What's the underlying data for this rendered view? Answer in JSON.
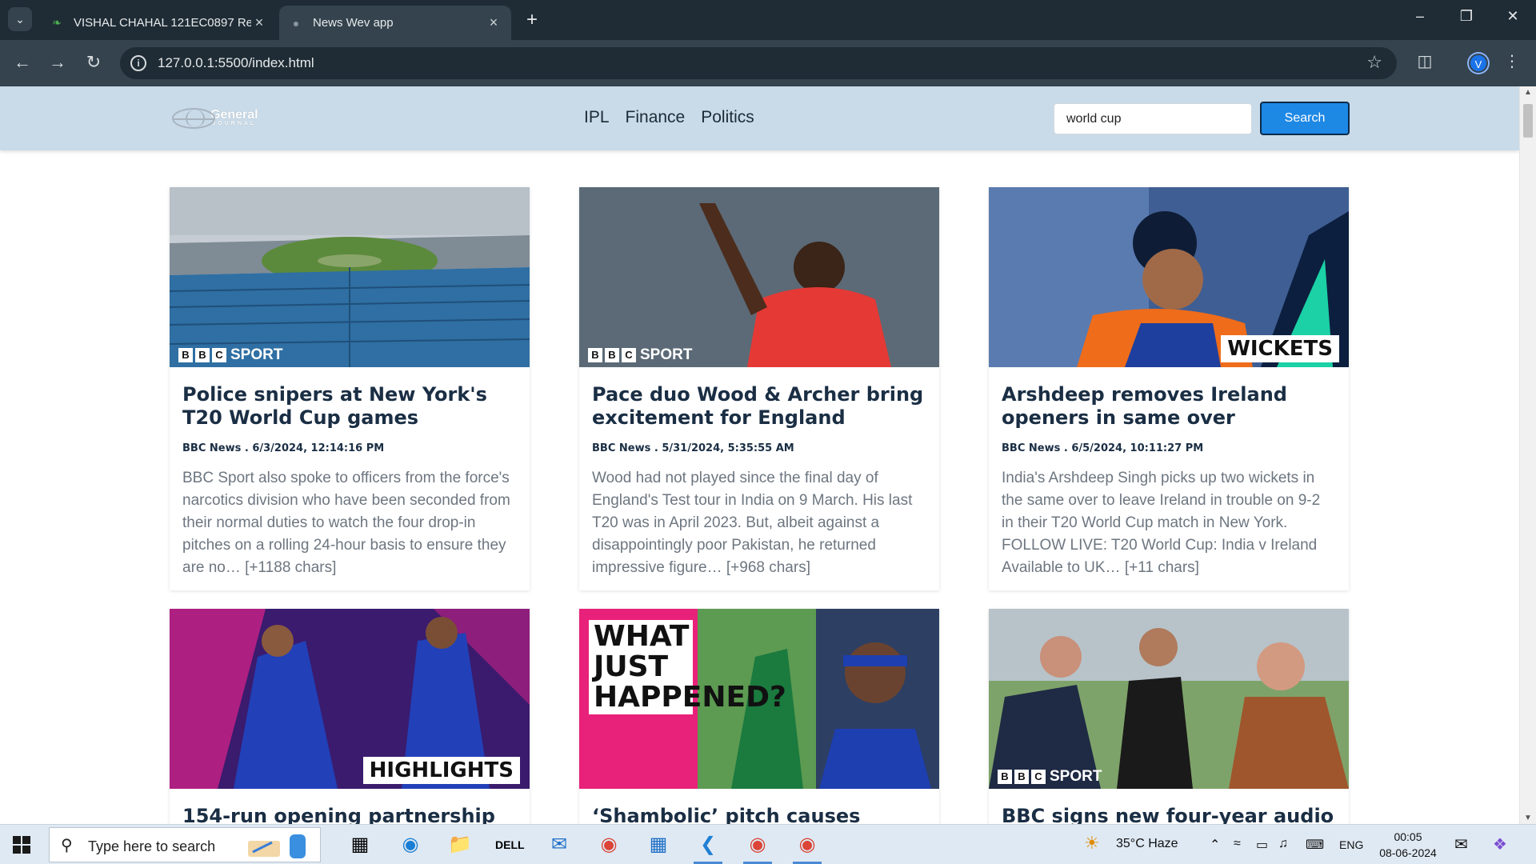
{
  "browser": {
    "tabs": [
      {
        "title": "VISHAL CHAHAL 121EC0897 Re",
        "active": false
      },
      {
        "title": "News Wev app",
        "active": true
      }
    ],
    "url": "127.0.0.1:5500/index.html",
    "profile_initial": "V"
  },
  "site": {
    "logo_text": "General",
    "logo_subtext": "JOURNAL",
    "nav": [
      "IPL",
      "Finance",
      "Politics"
    ],
    "search": {
      "value": "world cup",
      "button_label": "Search"
    }
  },
  "cards": [
    {
      "title": "Police snipers at New York's T20 World Cup games",
      "meta": "BBC News . 6/3/2024, 12:14:16 PM",
      "description": "BBC Sport also spoke to officers from the force's narcotics division who have been seconded from their normal duties to watch the four drop-in pitches on a rolling 24-hour basis to ensure they are no… [+1188 chars]",
      "image_badge": "SPORT",
      "image_tag": ""
    },
    {
      "title": "Pace duo Wood & Archer bring excitement for England",
      "meta": "BBC News . 5/31/2024, 5:35:55 AM",
      "description": "Wood had not played since the final day of England's Test tour in India on 9 March. His last T20 was in April 2023. But, albeit against a disappointingly poor Pakistan, he returned impressive figure… [+968 chars]",
      "image_badge": "SPORT",
      "image_tag": ""
    },
    {
      "title": "Arshdeep removes Ireland openers in same over",
      "meta": "BBC News . 6/5/2024, 10:11:27 PM",
      "description": "India's Arshdeep Singh picks up two wickets in the same over to leave Ireland in trouble on 9-2 in their T20 World Cup match in New York. FOLLOW LIVE: T20 World Cup: India v Ireland Available to UK… [+11 chars]",
      "image_badge": "",
      "image_tag": "WICKETS"
    },
    {
      "title": "154-run opening partnership",
      "meta": "",
      "description": "",
      "image_badge": "",
      "image_tag": "HIGHLIGHTS"
    },
    {
      "title": "‘Shambolic’ pitch causes havoc",
      "meta": "",
      "description": "",
      "image_badge": "",
      "image_tag": "",
      "image_headline": [
        "WHAT",
        "JUST",
        "HAPPENED?"
      ]
    },
    {
      "title": "BBC signs new four-year audio",
      "meta": "",
      "description": "",
      "image_badge": "SPORT",
      "image_tag": ""
    }
  ],
  "taskbar": {
    "search_placeholder": "Type here to search",
    "weather": "35°C  Haze",
    "language": "ENG",
    "time": "00:05",
    "date": "08-06-2024"
  },
  "colors": {
    "nav_background": "#c9dbe9",
    "search_button": "#1e88e5",
    "headline": "#1a2e44",
    "description_text": "#6d7680",
    "chrome_dark": "#1f2c35"
  }
}
